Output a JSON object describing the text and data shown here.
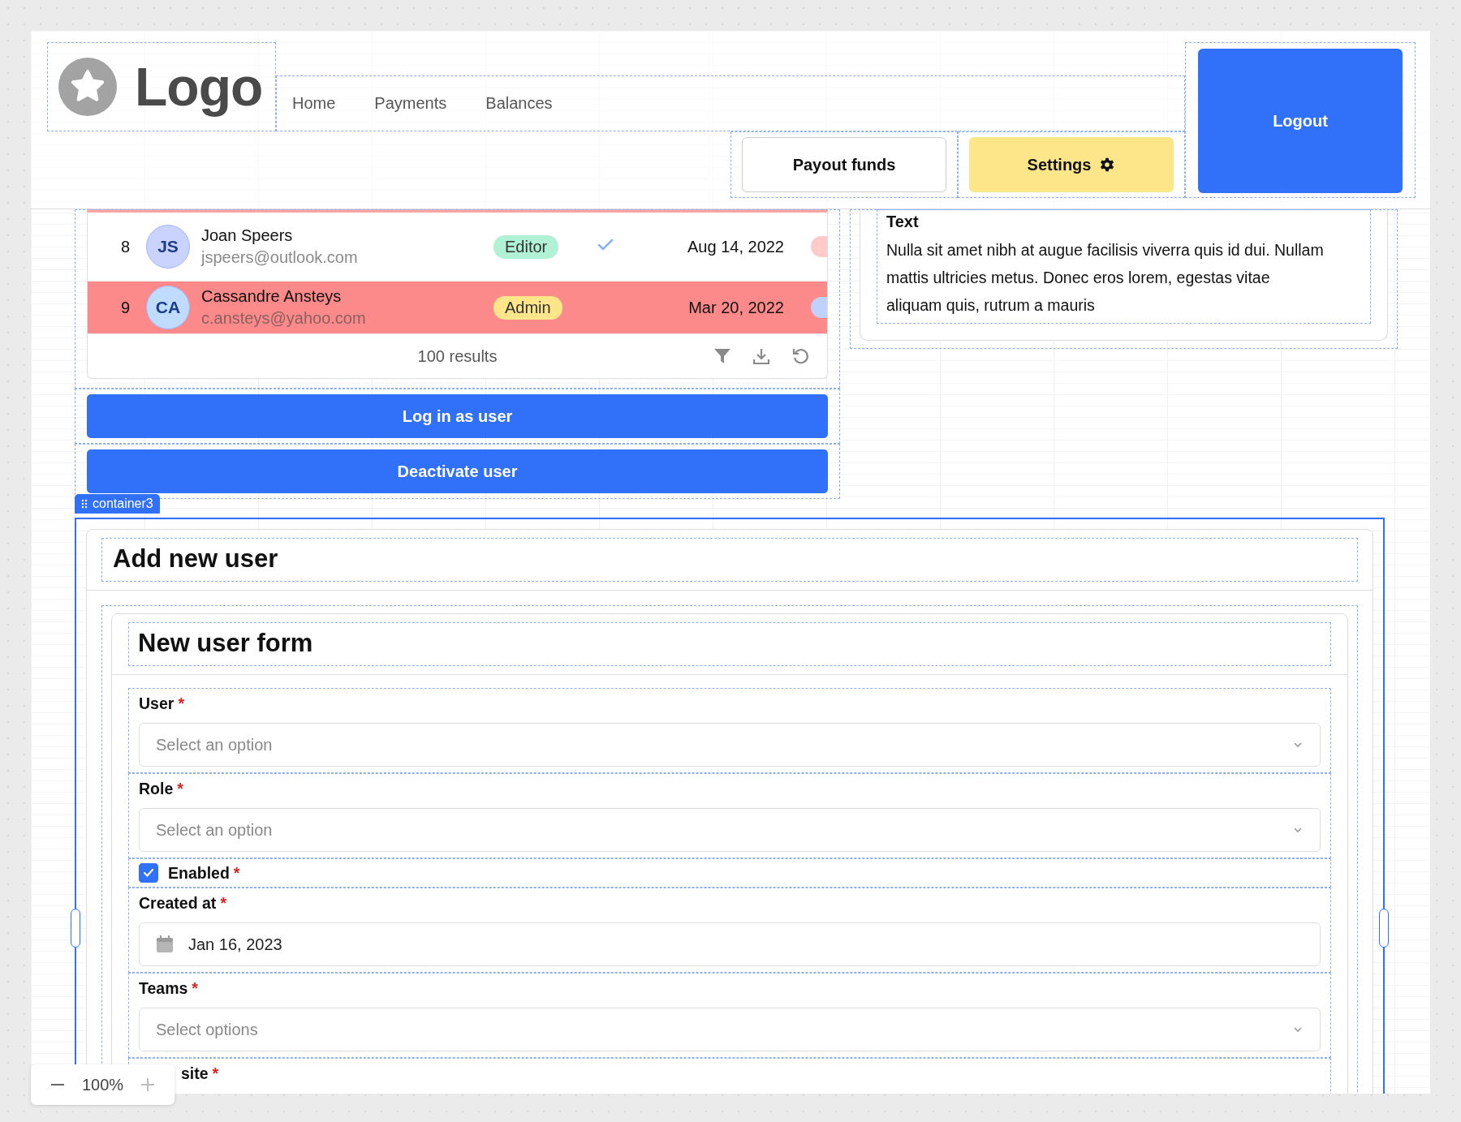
{
  "header": {
    "logo_text": "Logo",
    "nav": [
      {
        "label": "Home"
      },
      {
        "label": "Payments"
      },
      {
        "label": "Balances"
      }
    ],
    "buttons": [
      {
        "label": "Payout funds",
        "kind": "outline"
      },
      {
        "label": "Settings",
        "kind": "warning"
      }
    ],
    "logout": {
      "label": "Logout"
    }
  },
  "users_table": {
    "rows": [
      {
        "index": "8",
        "avatar": {
          "initials": "JS",
          "color": "#c9d3fd"
        },
        "name": "Joan Speers",
        "email": "jspeers@outlook.com",
        "role": {
          "label": "Editor",
          "color": "#b1f2d6"
        },
        "verified": true,
        "date": "Aug 14, 2022",
        "tag": {
          "color": "#fecaca"
        },
        "highlighted": false
      },
      {
        "index": "9",
        "avatar": {
          "initials": "CA",
          "color": "#bfdbfe"
        },
        "name": "Cassandre Ansteys",
        "email": "c.ansteys@yahoo.com",
        "role": {
          "label": "Admin",
          "color": "#fde68a"
        },
        "verified": false,
        "date": "Mar 20, 2022",
        "tag": {
          "color": "#bfd2fe"
        },
        "highlighted": true
      }
    ],
    "results": "100 results"
  },
  "actions": [
    {
      "label": "Log in as user"
    },
    {
      "label": "Deactivate user"
    }
  ],
  "text_panel": {
    "title": "Text",
    "body": "Nulla sit amet nibh at augue facilisis viverra quis id dui. Nullam mattis ultricies metus. Donec eros lorem, egestas vitae aliquam quis, rutrum a mauris"
  },
  "container_tag": "container3",
  "required_mark": "*",
  "add_user": {
    "title": "Add new user",
    "form": {
      "title": "New user form",
      "fields": [
        {
          "kind": "select",
          "label": "User",
          "required": true,
          "placeholder": "Select an option"
        },
        {
          "kind": "select",
          "label": "Role",
          "required": true,
          "placeholder": "Select an option"
        },
        {
          "kind": "checkbox",
          "label": "Enabled",
          "required": true,
          "checked": true
        },
        {
          "kind": "date",
          "label": "Created at",
          "required": true,
          "value": "Jan 16, 2023"
        },
        {
          "kind": "select",
          "label": "Teams",
          "required": true,
          "placeholder": "Select options"
        },
        {
          "kind": "partial",
          "label": "site",
          "required": true
        }
      ]
    }
  },
  "zoom": {
    "value": "100%"
  }
}
